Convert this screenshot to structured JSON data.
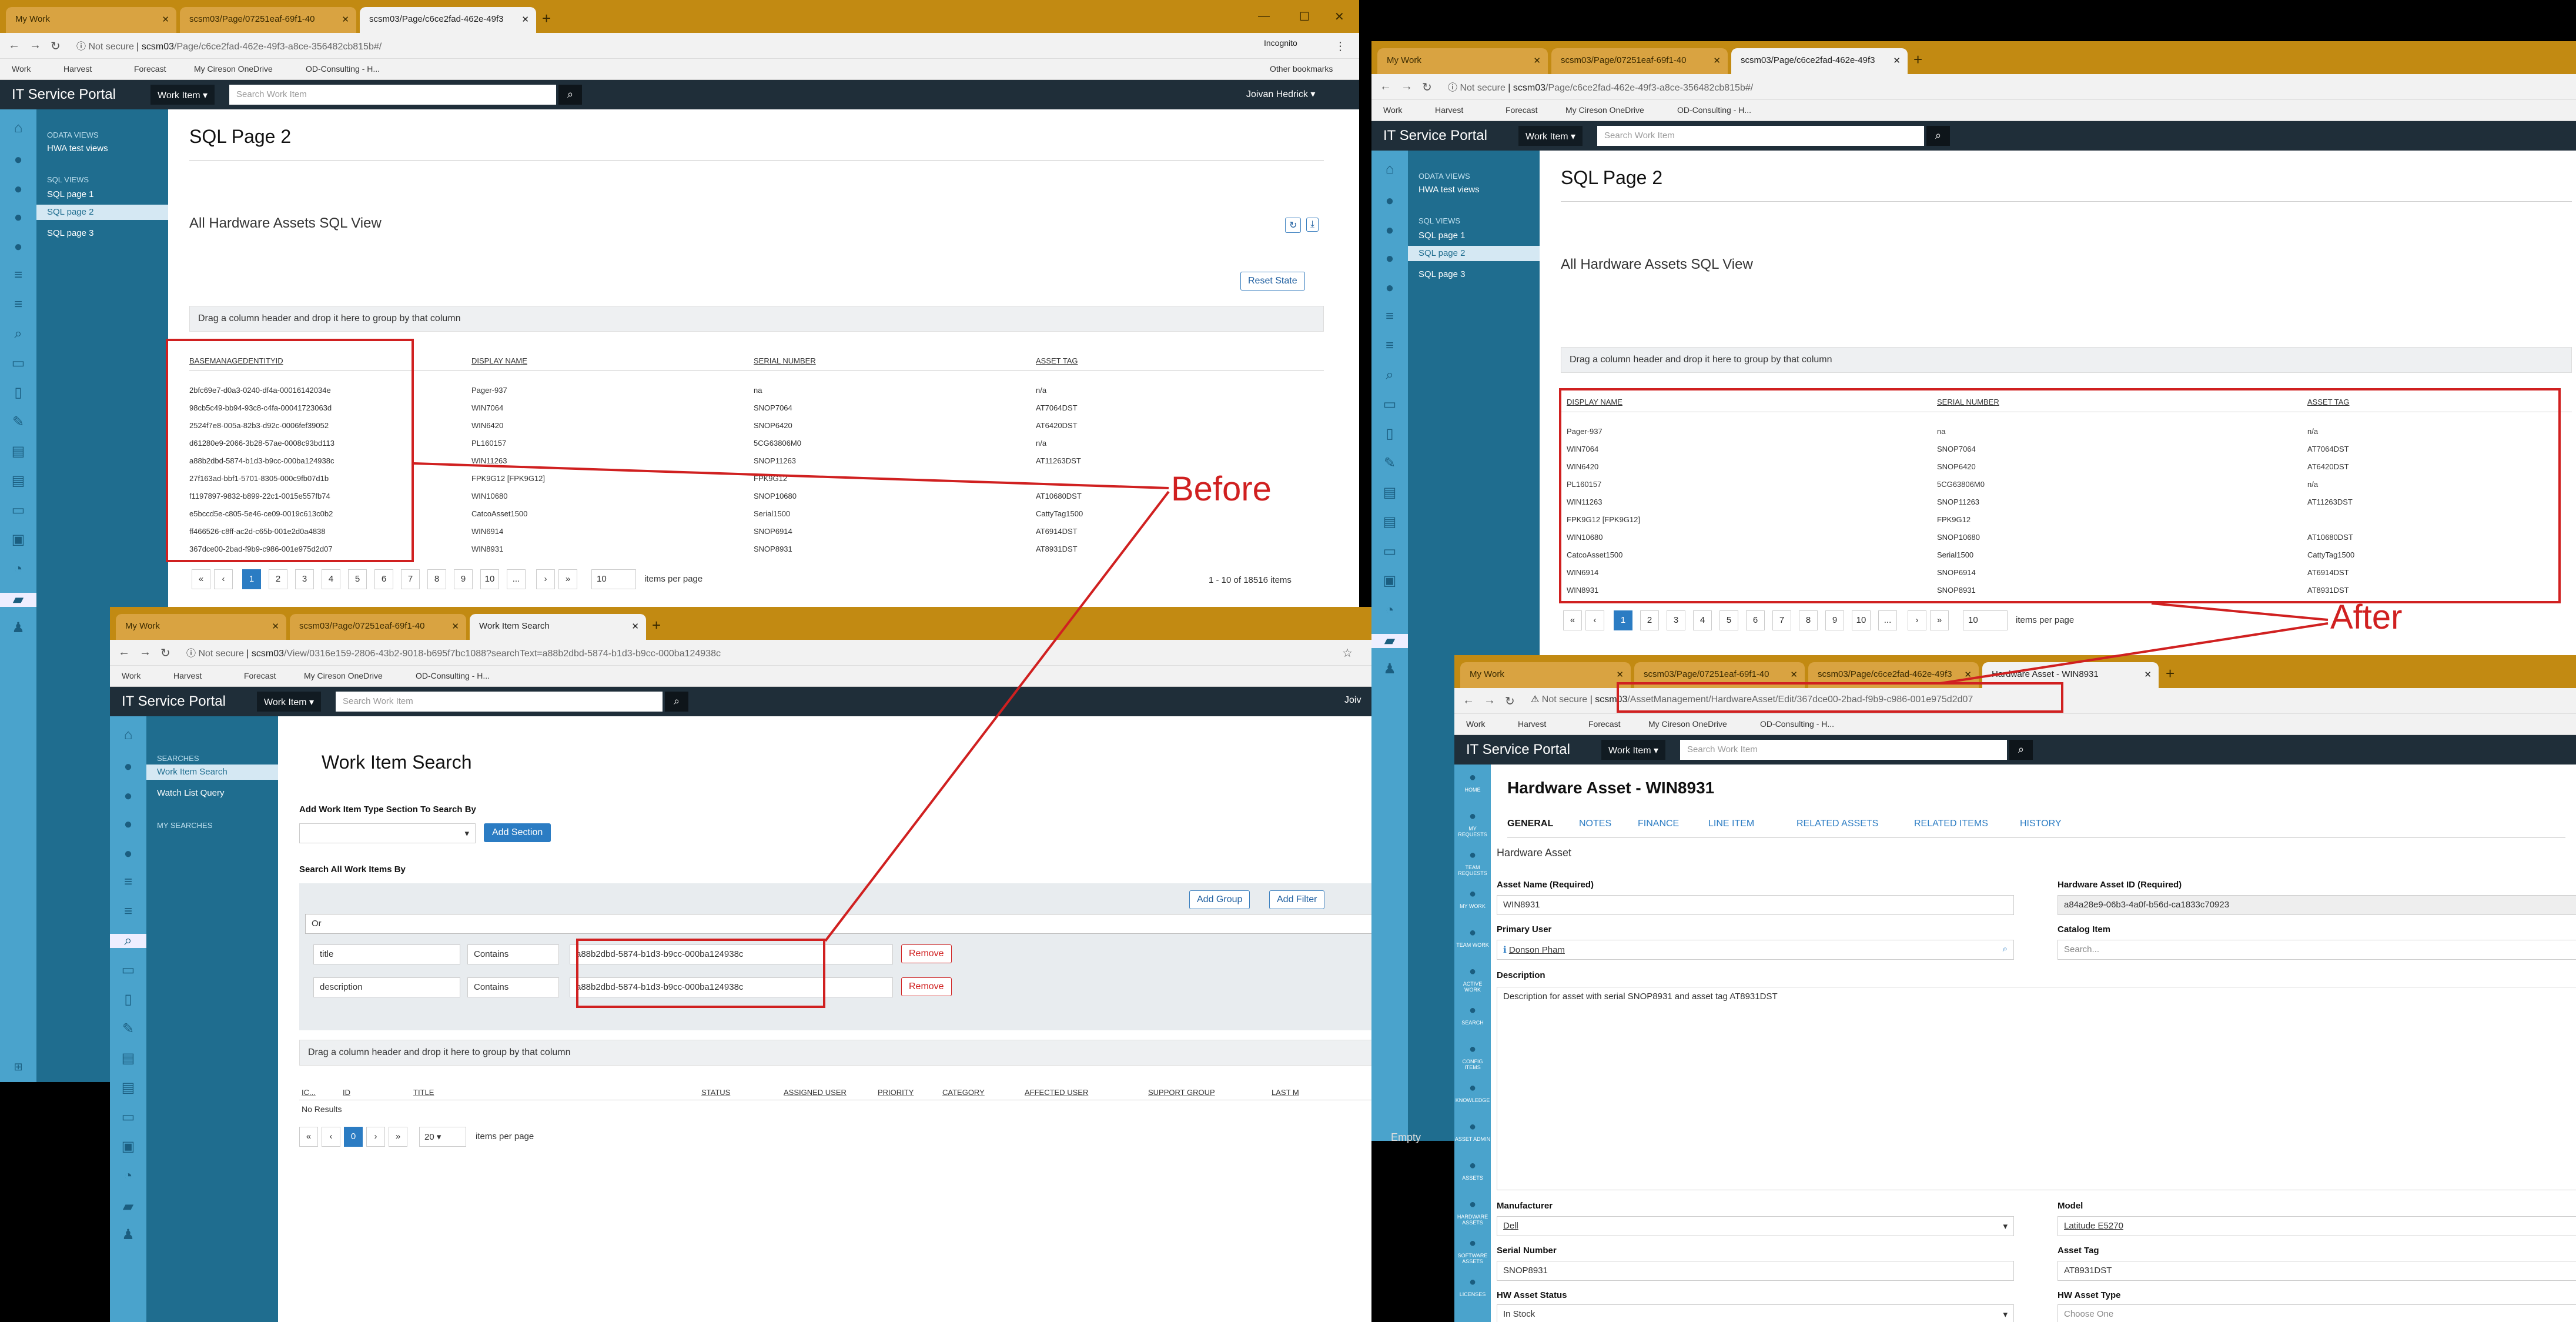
{
  "annotations": {
    "before": "Before",
    "after": "After",
    "empty": "Empty"
  },
  "common": {
    "brand": "IT Service Portal",
    "work_item": "Work Item ▾",
    "search_placeholder": "Search Work Item",
    "not_secure": "Not secure",
    "incognito": "Incognito",
    "other_bookmarks": "Other bookmarks",
    "bookmarks": [
      "Work",
      "Harvest",
      "Forecast",
      "My Cireson OneDrive",
      "OD-Consulting - H..."
    ],
    "user": "Joivan Hedrick ▾",
    "user_short": "Joiv"
  },
  "win1": {
    "tabs": [
      "My Work",
      "scsm03/Page/07251eaf-69f1-40",
      "scsm03/Page/c6ce2fad-462e-49f3"
    ],
    "url_host": "scsm03",
    "url_path": "/Page/c6ce2fad-462e-49f3-a8ce-356482cb815b#/",
    "side": {
      "odata": "ODATA VIEWS",
      "hwa": "HWA test views",
      "sqlviews": "SQL VIEWS",
      "p1": "SQL page 1",
      "p2": "SQL page 2",
      "p3": "SQL page 3"
    },
    "page_title": "SQL Page 2",
    "section_title": "All Hardware Assets SQL View",
    "reset": "Reset State",
    "dropzone": "Drag a column header and drop it here to group by that column",
    "headers": [
      "BASEMANAGEDENTITYID",
      "DISPLAY NAME",
      "SERIAL NUMBER",
      "ASSET TAG"
    ],
    "rows": [
      [
        "2bfc69e7-d0a3-0240-df4a-00016142034e",
        "Pager-937",
        "na",
        "n/a"
      ],
      [
        "98cb5c49-bb94-93c8-c4fa-00041723063d",
        "WIN7064",
        "SNOP7064",
        "AT7064DST"
      ],
      [
        "2524f7e8-005a-82b3-d92c-0006fef39052",
        "WIN6420",
        "SNOP6420",
        "AT6420DST"
      ],
      [
        "d61280e9-2066-3b28-57ae-0008c93bd113",
        "PL160157",
        "5CG63806M0",
        "n/a"
      ],
      [
        "a88b2dbd-5874-b1d3-b9cc-000ba124938c",
        "WIN11263",
        "SNOP11263",
        "AT11263DST"
      ],
      [
        "27f163ad-bbf1-5701-8305-000c9fb07d1b",
        "FPK9G12 [FPK9G12]",
        "FPK9G12",
        ""
      ],
      [
        "f1197897-9832-b899-22c1-0015e557fb74",
        "WIN10680",
        "SNOP10680",
        "AT10680DST"
      ],
      [
        "e5bccd5e-c805-5e46-ce09-0019c613c0b2",
        "CatcoAsset1500",
        "Serial1500",
        "CattyTag1500"
      ],
      [
        "ff466526-c8ff-ac2d-c65b-001e2d0a4838",
        "WIN6914",
        "SNOP6914",
        "AT6914DST"
      ],
      [
        "367dce00-2bad-f9b9-c986-001e975d2d07",
        "WIN8931",
        "SNOP8931",
        "AT8931DST"
      ]
    ],
    "pages": [
      "1",
      "2",
      "3",
      "4",
      "5",
      "6",
      "7",
      "8",
      "9",
      "10",
      "..."
    ],
    "per_page": "10",
    "per_page_label": "items per page",
    "summary": "1 - 10 of 18516 items"
  },
  "win2": {
    "tabs": [
      "My Work",
      "scsm03/Page/07251eaf-69f1-40",
      "Work Item Search"
    ],
    "url_host": "scsm03",
    "url_path": "/View/0316e159-2806-43b2-9018-b695f7bc1088?searchText=a88b2dbd-5874-b1d3-b9cc-000ba124938c",
    "side": {
      "searches": "SEARCHES",
      "wis": "Work Item Search",
      "wlq": "Watch List Query",
      "mys": "MY SEARCHES"
    },
    "page_title": "Work Item Search",
    "add_label": "Add Work Item Type Section To Search By",
    "add_section": "Add Section",
    "search_all": "Search All Work Items By",
    "add_group": "Add Group",
    "add_filter": "Add Filter",
    "or": "Or",
    "criteria": [
      {
        "field": "title",
        "op": "Contains",
        "value": "a88b2dbd-5874-b1d3-b9cc-000ba124938c"
      },
      {
        "field": "description",
        "op": "Contains",
        "value": "a88b2dbd-5874-b1d3-b9cc-000ba124938c"
      }
    ],
    "remove": "Remove",
    "dropzone": "Drag a column header and drop it here to group by that column",
    "headers": [
      "IC...",
      "ID",
      "TITLE",
      "STATUS",
      "ASSIGNED USER",
      "PRIORITY",
      "CATEGORY",
      "AFFECTED USER",
      "SUPPORT GROUP",
      "LAST M"
    ],
    "no_results": "No Results",
    "page": "0",
    "per_page": "20",
    "per_page_label": "items per page"
  },
  "win3": {
    "tabs": [
      "My Work",
      "scsm03/Page/07251eaf-69f1-40",
      "scsm03/Page/c6ce2fad-462e-49f3"
    ],
    "url_host": "scsm03",
    "url_path": "/Page/c6ce2fad-462e-49f3-a8ce-356482cb815b#/",
    "page_title": "SQL Page 2",
    "section_title": "All Hardware Assets SQL View",
    "dropzone": "Drag a column header and drop it here to group by that column",
    "headers": [
      "DISPLAY NAME",
      "SERIAL NUMBER",
      "ASSET TAG"
    ],
    "rows": [
      [
        "Pager-937",
        "na",
        "n/a"
      ],
      [
        "WIN7064",
        "SNOP7064",
        "AT7064DST"
      ],
      [
        "WIN6420",
        "SNOP6420",
        "AT6420DST"
      ],
      [
        "PL160157",
        "5CG63806M0",
        "n/a"
      ],
      [
        "WIN11263",
        "SNOP11263",
        "AT11263DST"
      ],
      [
        "FPK9G12 [FPK9G12]",
        "FPK9G12",
        ""
      ],
      [
        "WIN10680",
        "SNOP10680",
        "AT10680DST"
      ],
      [
        "CatcoAsset1500",
        "Serial1500",
        "CattyTag1500"
      ],
      [
        "WIN6914",
        "SNOP6914",
        "AT6914DST"
      ],
      [
        "WIN8931",
        "SNOP8931",
        "AT8931DST"
      ]
    ],
    "pages": [
      "1",
      "2",
      "3",
      "4",
      "5",
      "6",
      "7",
      "8",
      "9",
      "10",
      "..."
    ],
    "per_page": "10",
    "per_page_label": "items per page"
  },
  "win4": {
    "tabs": [
      "My Work",
      "scsm03/Page/07251eaf-69f1-40",
      "scsm03/Page/c6ce2fad-462e-49f3",
      "Hardware Asset - WIN8931"
    ],
    "url_host": "scsm03",
    "url_path": "/AssetManagement/HardwareAsset/Edit/367dce00-2bad-f9b9-c986-001e975d2d07",
    "rail": [
      "HOME",
      "MY REQUESTS",
      "TEAM REQUESTS",
      "MY WORK",
      "TEAM WORK",
      "ACTIVE WORK",
      "SEARCH",
      "CONFIG ITEMS",
      "KNOWLEDGE",
      "ASSET ADMIN",
      "ASSETS",
      "HARDWARE ASSETS",
      "SOFTWARE ASSETS",
      "LICENSES"
    ],
    "title": "Hardware Asset - WIN8931",
    "tabs2": [
      "GENERAL",
      "NOTES",
      "FINANCE",
      "LINE ITEM",
      "RELATED ASSETS",
      "RELATED ITEMS",
      "HISTORY"
    ],
    "section": "Hardware Asset",
    "asset_name_label": "Asset Name (Required)",
    "asset_name": "WIN8931",
    "asset_id_label": "Hardware Asset ID (Required)",
    "asset_id": "a84a28e9-06b3-4a0f-b56d-ca1833c70923",
    "primary_user_label": "Primary User",
    "primary_user": "Donson Pham",
    "catalog_label": "Catalog Item",
    "catalog_ph": "Search...",
    "desc_label": "Description",
    "desc": "Description for asset with serial SNOP8931 and asset tag AT8931DST",
    "manufacturer_label": "Manufacturer",
    "manufacturer": "Dell",
    "model_label": "Model",
    "model": "Latitude E5270",
    "serial_label": "Serial Number",
    "serial": "SNOP8931",
    "tag_label": "Asset Tag",
    "tag": "AT8931DST",
    "status_label": "HW Asset Status",
    "status": "In Stock",
    "type_label": "HW Asset Type",
    "type_ph": "Choose One"
  }
}
